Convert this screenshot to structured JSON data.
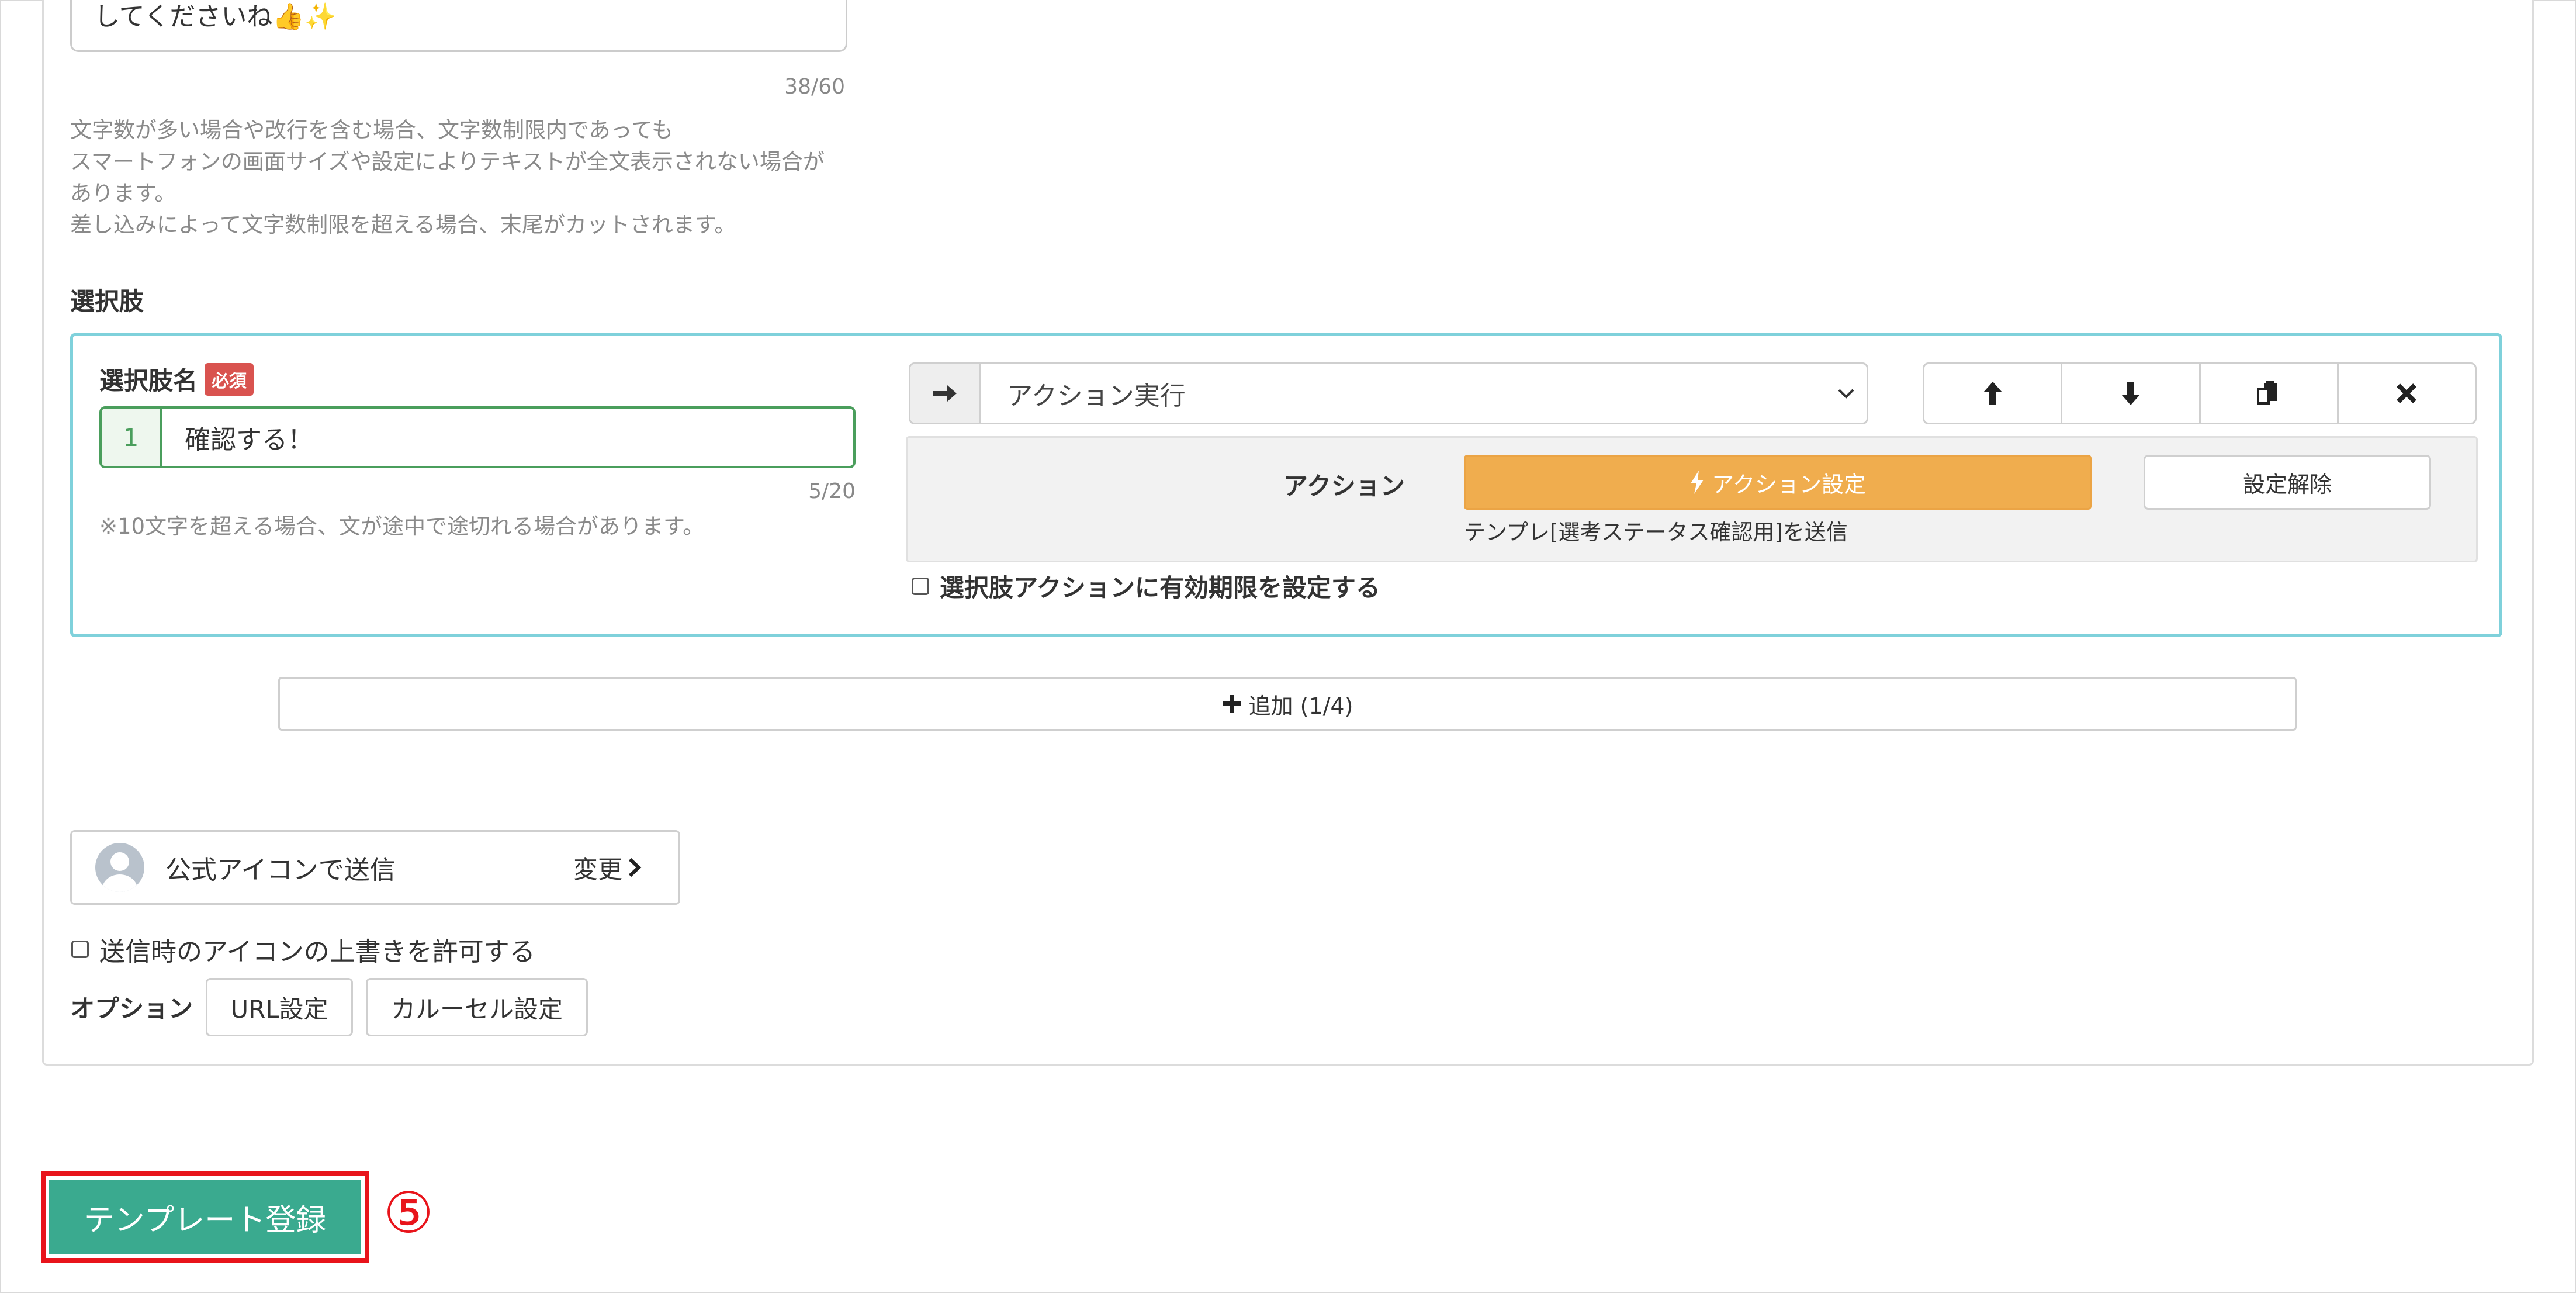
{
  "message_field": {
    "value_tail": "してくださいね👍✨",
    "counter": "38/60",
    "help_lines": [
      "文字数が多い場合や改行を含む場合、文字数制限内であっても",
      "スマートフォンの画面サイズや設定によりテキストが全文表示されない場合が",
      "あります。",
      "差し込みによって文字数制限を超える場合、末尾がカットされます。"
    ]
  },
  "choices": {
    "section_label": "選択肢",
    "item": {
      "name_label": "選択肢名",
      "required_badge": "必須",
      "index": "1",
      "value": "確認する！",
      "counter": "5/20",
      "note": "※10文字を超える場合、文が途中で途切れる場合があります。",
      "action_type_selected": "アクション実行",
      "action_label": "アクション",
      "action_settings_button": "アクション設定",
      "action_clear_button": "設定解除",
      "action_description": "テンプレ[選考ステータス確認用]を送信",
      "expiry_checkbox_label": "選択肢アクションに有効期限を設定する"
    },
    "add_button": "追加 (1/4)"
  },
  "sender": {
    "label": "公式アイコンで送信",
    "change_label": "変更"
  },
  "override_checkbox_label": "送信時のアイコンの上書きを許可する",
  "options": {
    "label": "オプション",
    "url_button": "URL設定",
    "carousel_button": "カルーセル設定"
  },
  "submit": {
    "label": "テンプレート登録",
    "step_marker": "⑤"
  },
  "colors": {
    "primary": "#3aaa8f",
    "action_orange": "#f0ad4e",
    "required_red": "#d9534f",
    "highlight_red": "#e8141b",
    "focus_border": "#7fd1db",
    "input_green": "#4a9e5c"
  }
}
